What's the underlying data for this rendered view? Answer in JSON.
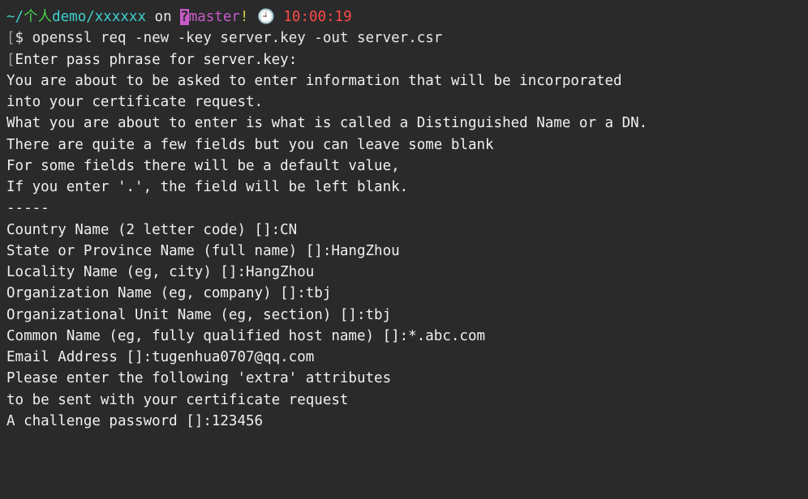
{
  "prompt": {
    "path_tilde": "~",
    "path_slash": "/",
    "path_seg1": "个人",
    "path_seg2": "demo/xxxxxx",
    "on": " on ",
    "branch_q": "?",
    "branch": "master",
    "bang": "!",
    "clock_icon": " 🕘 ",
    "time": "10:00:19"
  },
  "cmd": {
    "ps": "$ ",
    "text": "openssl req -new -key server.key -out server.csr"
  },
  "lines": {
    "l1": "Enter pass phrase for server.key:",
    "l2": "You are about to be asked to enter information that will be incorporated",
    "l3": "into your certificate request.",
    "l4": "What you are about to enter is what is called a Distinguished Name or a DN.",
    "l5": "There are quite a few fields but you can leave some blank",
    "l6": "For some fields there will be a default value,",
    "l7": "If you enter '.', the field will be left blank.",
    "l8": "-----",
    "l9": "Country Name (2 letter code) []:CN",
    "l10": "State or Province Name (full name) []:HangZhou",
    "l11": "Locality Name (eg, city) []:HangZhou",
    "l12": "Organization Name (eg, company) []:tbj",
    "l13": "Organizational Unit Name (eg, section) []:tbj",
    "l14": "Common Name (eg, fully qualified host name) []:*.abc.com",
    "l15": "Email Address []:tugenhua0707@qq.com",
    "l16": "",
    "l17": "Please enter the following 'extra' attributes",
    "l18": "to be sent with your certificate request",
    "l19": "A challenge password []:123456"
  }
}
